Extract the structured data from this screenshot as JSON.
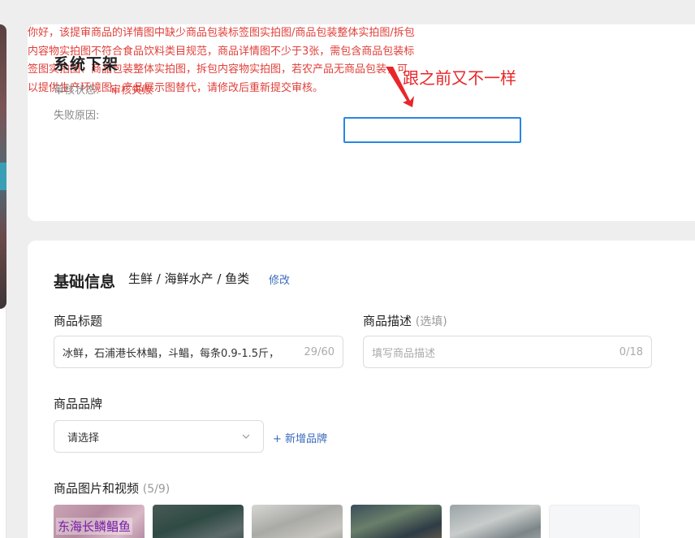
{
  "colors": {
    "accent_red": "#e0403a",
    "link_blue": "#3a6bbd",
    "annotation_box": "#2a86e0"
  },
  "audit": {
    "title": "系统下架",
    "status_label": "审核状态:",
    "status_value": "审核失败",
    "reason_label": "失败原因:",
    "reason_value": "你好，该提审商品的详情图中缺少商品包装标签图实拍图/商品包装整体实拍图/拆包内容物实拍图不符合食品饮料类目规范，商品详情图不少于3张，需包含商品包装标签图实拍图、商品包装整体实拍图，拆包内容物实拍图，若农产品无商品包装，可以提供生产环境图、产品展示图替代，请修改后重新提交审核。"
  },
  "annotation": {
    "text": "跟之前又不一样"
  },
  "basic": {
    "title": "基础信息",
    "category_path": "生鲜 / 海鲜水产 / 鱼类",
    "edit_label": "修改"
  },
  "fields": {
    "title_label": "商品标题",
    "title_value": "冰鲜，石浦港长林鲳，斗鲳，每条0.9-1.5斤，",
    "title_count": "29/60",
    "desc_label": "商品描述",
    "desc_optional": "(选填)",
    "desc_placeholder": "填写商品描述",
    "desc_count": "0/18",
    "brand_label": "商品品牌",
    "brand_selected": "请选择",
    "add_brand_label": "+ 新增品牌",
    "media_label": "商品图片和视频",
    "media_count": "(5/9)"
  },
  "thumbnails": [
    {
      "caption": "东海长鳞鲳鱼"
    },
    {
      "caption": ""
    },
    {
      "caption": ""
    },
    {
      "caption": ""
    },
    {
      "caption": ""
    }
  ]
}
